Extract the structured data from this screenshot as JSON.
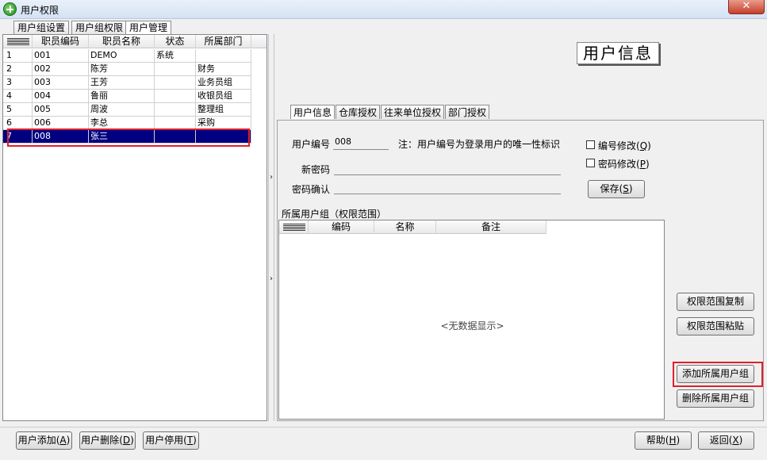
{
  "window": {
    "title": "用户权限",
    "close_glyph": "✕"
  },
  "top_tabs": [
    {
      "label": "用户组设置",
      "active": false
    },
    {
      "label": "用户组权限",
      "active": false
    },
    {
      "label": "用户管理",
      "active": true
    }
  ],
  "employee_grid": {
    "columns": [
      "职员编码",
      "职员名称",
      "状态",
      "所属部门"
    ],
    "rows": [
      {
        "idx": "1",
        "code": "001",
        "name": "DEMO",
        "status": "系统",
        "dept": ""
      },
      {
        "idx": "2",
        "code": "002",
        "name": "陈芳",
        "status": "",
        "dept": "财务"
      },
      {
        "idx": "3",
        "code": "003",
        "name": "王芳",
        "status": "",
        "dept": "业务员组"
      },
      {
        "idx": "4",
        "code": "004",
        "name": "鲁丽",
        "status": "",
        "dept": "收银员组"
      },
      {
        "idx": "5",
        "code": "005",
        "name": "周波",
        "status": "",
        "dept": "整理组"
      },
      {
        "idx": "6",
        "code": "006",
        "name": "李总",
        "status": "",
        "dept": "采购"
      },
      {
        "idx": "7",
        "code": "008",
        "name": "张三",
        "status": "",
        "dept": "",
        "selected": true
      }
    ]
  },
  "splitter": {
    "up_glyph": "›",
    "down_glyph": "›"
  },
  "heading": "用户信息",
  "right_tabs": [
    {
      "label": "用户信息",
      "active": true
    },
    {
      "label": "仓库授权",
      "active": false
    },
    {
      "label": "往来单位授权",
      "active": false
    },
    {
      "label": "部门授权",
      "active": false
    }
  ],
  "form": {
    "user_code_label": "用户编号",
    "user_code_value": "008",
    "note": "注：用户编号为登录用户的唯一性标识",
    "new_password_label": "新密码",
    "confirm_password_label": "密码确认",
    "edit_code_label": "编号修改",
    "edit_code_key": "Q",
    "edit_password_label": "密码修改",
    "edit_password_key": "P",
    "save_label": "保存",
    "save_key": "S"
  },
  "group_section": {
    "title": "所属用户组（权限范围）",
    "columns": [
      "编码",
      "名称",
      "备注"
    ],
    "empty_text": "<无数据显示>"
  },
  "side_buttons": {
    "copy_scope": "权限范围复制",
    "paste_scope": "权限范围粘贴",
    "add_group": "添加所属用户组",
    "delete_group": "删除所属用户组"
  },
  "bottom_buttons": {
    "add_user": "用户添加",
    "add_user_key": "A",
    "delete_user": "用户删除",
    "delete_user_key": "D",
    "disable_user": "用户停用",
    "disable_user_key": "T",
    "help": "帮助",
    "help_key": "H",
    "back": "返回",
    "back_key": "X"
  },
  "highlight_color": "#e0202a",
  "selection_color": "#000080"
}
